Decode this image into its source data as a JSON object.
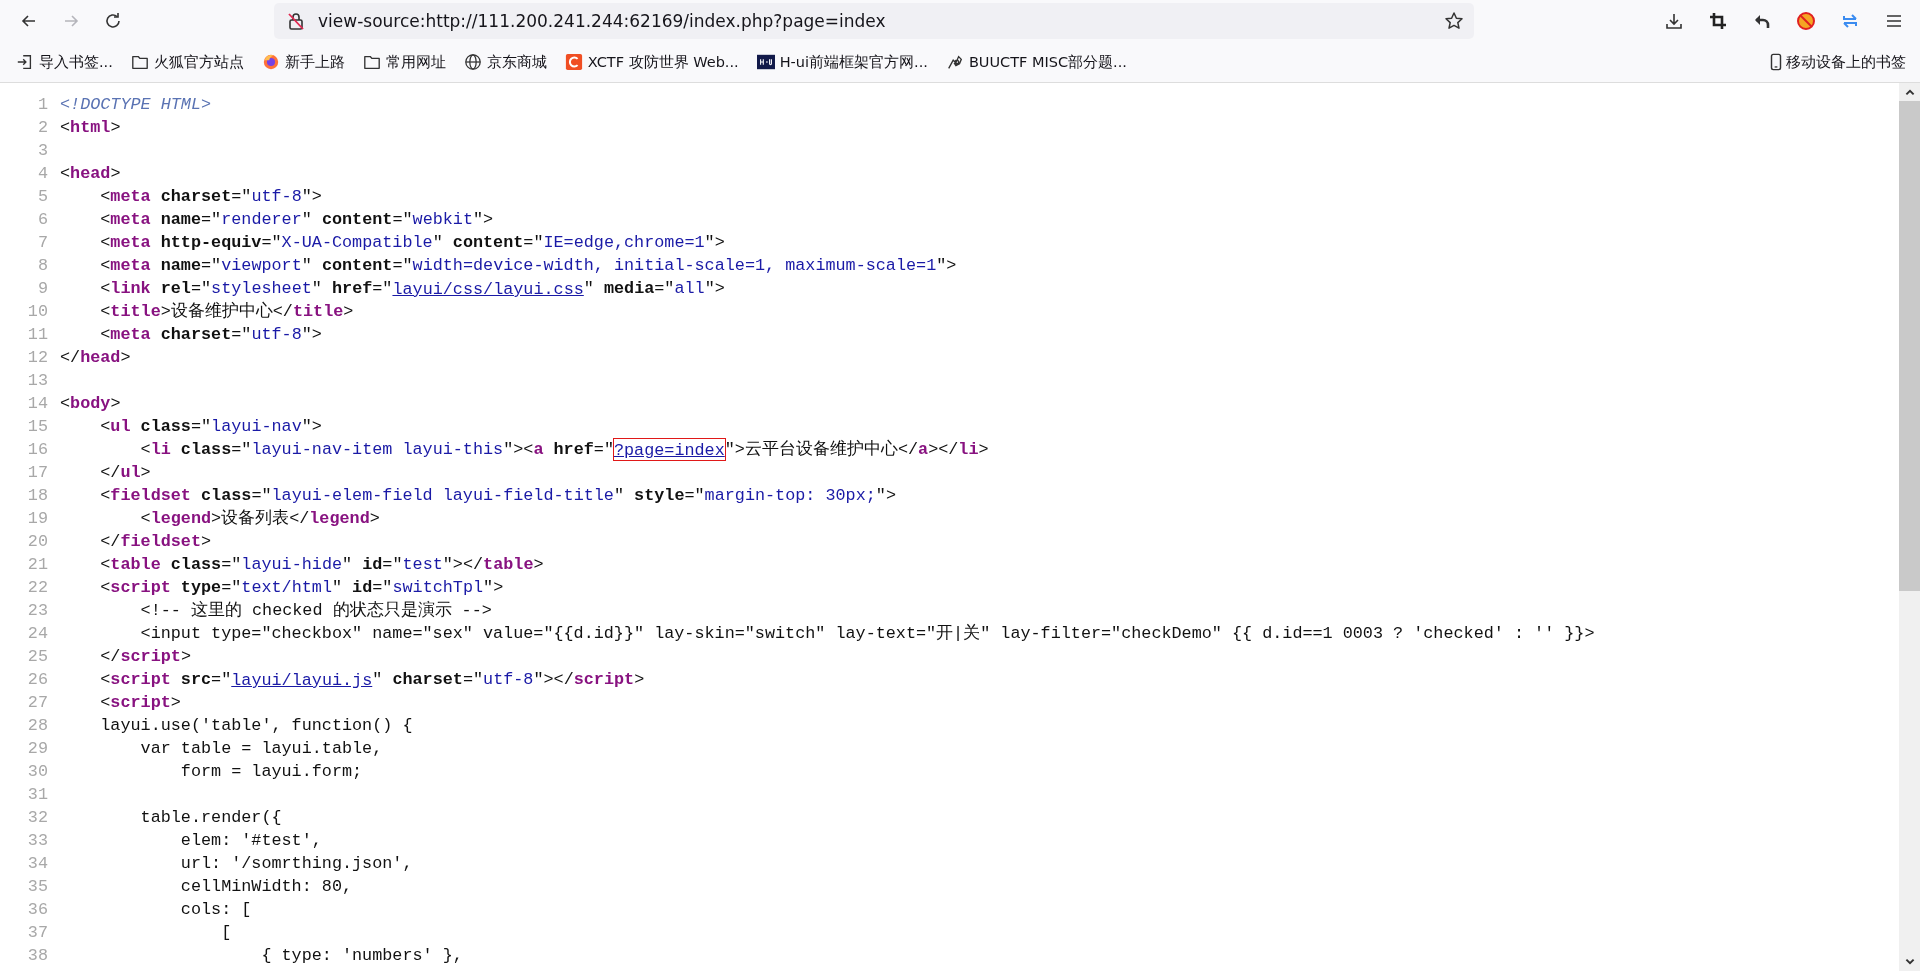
{
  "toolbar": {
    "nav_buttons": [
      {
        "kind": "back",
        "disabled": false
      },
      {
        "kind": "forward",
        "disabled": true
      },
      {
        "kind": "reload",
        "disabled": false
      }
    ],
    "url": "view-source:http://111.200.241.244:62169/index.php?page=index",
    "actions": [
      {
        "kind": "download"
      },
      {
        "kind": "crop"
      },
      {
        "kind": "undo"
      },
      {
        "kind": "addon"
      },
      {
        "kind": "sync"
      },
      {
        "kind": "menu"
      }
    ]
  },
  "bookmarks": [
    {
      "kind": "import",
      "label": "导入书签..."
    },
    {
      "kind": "folder",
      "label": "火狐官方站点"
    },
    {
      "kind": "firefox",
      "label": "新手上路"
    },
    {
      "kind": "folder",
      "label": "常用网址"
    },
    {
      "kind": "globe",
      "label": "京东商城"
    },
    {
      "kind": "c-logo",
      "label": "XCTF 攻防世界 Web..."
    },
    {
      "kind": "hui",
      "label": "H-ui前端框架官方网..."
    },
    {
      "kind": "bird",
      "label": "BUUCTF MISC部分题..."
    }
  ],
  "mobile_bookmarks": {
    "label": "移动设备上的书签"
  },
  "source_lines": [
    {
      "number": "1",
      "segments": [
        {
          "kind": "doctype",
          "text": "<!DOCTYPE HTML>"
        }
      ]
    },
    {
      "number": "2",
      "segments": [
        {
          "kind": "plain",
          "text": "<"
        },
        {
          "kind": "tag",
          "text": "html"
        },
        {
          "kind": "plain",
          "text": ">"
        }
      ]
    },
    {
      "number": "3"
    },
    {
      "number": "4",
      "segments": [
        {
          "kind": "plain",
          "text": "<"
        },
        {
          "kind": "tag",
          "text": "head"
        },
        {
          "kind": "plain",
          "text": ">"
        }
      ]
    },
    {
      "number": "5",
      "segments": [
        {
          "kind": "plain",
          "text": "    <"
        },
        {
          "kind": "tag",
          "text": "meta"
        },
        {
          "kind": "attr",
          "text": " charset"
        },
        {
          "kind": "plain",
          "text": "=\""
        },
        {
          "kind": "value",
          "text": "utf-8"
        },
        {
          "kind": "plain",
          "text": "\">"
        }
      ]
    },
    {
      "number": "6",
      "segments": [
        {
          "kind": "plain",
          "text": "    <"
        },
        {
          "kind": "tag",
          "text": "meta"
        },
        {
          "kind": "attr",
          "text": " name"
        },
        {
          "kind": "plain",
          "text": "=\""
        },
        {
          "kind": "value",
          "text": "renderer"
        },
        {
          "kind": "plain",
          "text": "\" "
        },
        {
          "kind": "attr",
          "text": "content"
        },
        {
          "kind": "plain",
          "text": "=\""
        },
        {
          "kind": "value",
          "text": "webkit"
        },
        {
          "kind": "plain",
          "text": "\">"
        }
      ]
    },
    {
      "number": "7",
      "segments": [
        {
          "kind": "plain",
          "text": "    <"
        },
        {
          "kind": "tag",
          "text": "meta"
        },
        {
          "kind": "attr",
          "text": " http-equiv"
        },
        {
          "kind": "plain",
          "text": "=\""
        },
        {
          "kind": "value",
          "text": "X-UA-Compatible"
        },
        {
          "kind": "plain",
          "text": "\" "
        },
        {
          "kind": "attr",
          "text": "content"
        },
        {
          "kind": "plain",
          "text": "=\""
        },
        {
          "kind": "value",
          "text": "IE=edge,chrome=1"
        },
        {
          "kind": "plain",
          "text": "\">"
        }
      ]
    },
    {
      "number": "8",
      "segments": [
        {
          "kind": "plain",
          "text": "    <"
        },
        {
          "kind": "tag",
          "text": "meta"
        },
        {
          "kind": "attr",
          "text": " name"
        },
        {
          "kind": "plain",
          "text": "=\""
        },
        {
          "kind": "value",
          "text": "viewport"
        },
        {
          "kind": "plain",
          "text": "\" "
        },
        {
          "kind": "attr",
          "text": "content"
        },
        {
          "kind": "plain",
          "text": "=\""
        },
        {
          "kind": "value",
          "text": "width=device-width, initial-scale=1, maximum-scale=1"
        },
        {
          "kind": "plain",
          "text": "\">"
        }
      ]
    },
    {
      "number": "9",
      "segments": [
        {
          "kind": "plain",
          "text": "    <"
        },
        {
          "kind": "tag",
          "text": "link"
        },
        {
          "kind": "attr",
          "text": " rel"
        },
        {
          "kind": "plain",
          "text": "=\""
        },
        {
          "kind": "value",
          "text": "stylesheet"
        },
        {
          "kind": "plain",
          "text": "\" "
        },
        {
          "kind": "attr",
          "text": "href"
        },
        {
          "kind": "plain",
          "text": "=\""
        },
        {
          "kind": "link",
          "text": "layui/css/layui.css"
        },
        {
          "kind": "plain",
          "text": "\" "
        },
        {
          "kind": "attr",
          "text": "media"
        },
        {
          "kind": "plain",
          "text": "=\""
        },
        {
          "kind": "value",
          "text": "all"
        },
        {
          "kind": "plain",
          "text": "\">"
        }
      ]
    },
    {
      "number": "10",
      "segments": [
        {
          "kind": "plain",
          "text": "    <"
        },
        {
          "kind": "tag",
          "text": "title"
        },
        {
          "kind": "plain",
          "text": ">设备维护中心</"
        },
        {
          "kind": "tag",
          "text": "title"
        },
        {
          "kind": "plain",
          "text": ">"
        }
      ]
    },
    {
      "number": "11",
      "segments": [
        {
          "kind": "plain",
          "text": "    <"
        },
        {
          "kind": "tag",
          "text": "meta"
        },
        {
          "kind": "attr",
          "text": " charset"
        },
        {
          "kind": "plain",
          "text": "=\""
        },
        {
          "kind": "value",
          "text": "utf-8"
        },
        {
          "kind": "plain",
          "text": "\">"
        }
      ]
    },
    {
      "number": "12",
      "segments": [
        {
          "kind": "plain",
          "text": "</"
        },
        {
          "kind": "tag",
          "text": "head"
        },
        {
          "kind": "plain",
          "text": ">"
        }
      ]
    },
    {
      "number": "13"
    },
    {
      "number": "14",
      "segments": [
        {
          "kind": "plain",
          "text": "<"
        },
        {
          "kind": "tag",
          "text": "body"
        },
        {
          "kind": "plain",
          "text": ">"
        }
      ]
    },
    {
      "number": "15",
      "segments": [
        {
          "kind": "plain",
          "text": "    <"
        },
        {
          "kind": "tag",
          "text": "ul"
        },
        {
          "kind": "attr",
          "text": " class"
        },
        {
          "kind": "plain",
          "text": "=\""
        },
        {
          "kind": "value",
          "text": "layui-nav"
        },
        {
          "kind": "plain",
          "text": "\">"
        }
      ]
    },
    {
      "number": "16",
      "segments": [
        {
          "kind": "plain",
          "text": "        <"
        },
        {
          "kind": "tag",
          "text": "li"
        },
        {
          "kind": "attr",
          "text": " class"
        },
        {
          "kind": "plain",
          "text": "=\""
        },
        {
          "kind": "value",
          "text": "layui-nav-item layui-this"
        },
        {
          "kind": "plain",
          "text": "\"><"
        },
        {
          "kind": "tag",
          "text": "a"
        },
        {
          "kind": "attr",
          "text": " href"
        },
        {
          "kind": "plain",
          "text": "=\""
        },
        {
          "kind": "link",
          "text": "?page=index",
          "highlighted": true
        },
        {
          "kind": "plain",
          "text": "\">云平台设备维护中心</"
        },
        {
          "kind": "tag",
          "text": "a"
        },
        {
          "kind": "plain",
          "text": "></"
        },
        {
          "kind": "tag",
          "text": "li"
        },
        {
          "kind": "plain",
          "text": ">"
        }
      ]
    },
    {
      "number": "17",
      "segments": [
        {
          "kind": "plain",
          "text": "    </"
        },
        {
          "kind": "tag",
          "text": "ul"
        },
        {
          "kind": "plain",
          "text": ">"
        }
      ]
    },
    {
      "number": "18",
      "segments": [
        {
          "kind": "plain",
          "text": "    <"
        },
        {
          "kind": "tag",
          "text": "fieldset"
        },
        {
          "kind": "attr",
          "text": " class"
        },
        {
          "kind": "plain",
          "text": "=\""
        },
        {
          "kind": "value",
          "text": "layui-elem-field layui-field-title"
        },
        {
          "kind": "plain",
          "text": "\" "
        },
        {
          "kind": "attr",
          "text": "style"
        },
        {
          "kind": "plain",
          "text": "=\""
        },
        {
          "kind": "value",
          "text": "margin-top: 30px;"
        },
        {
          "kind": "plain",
          "text": "\">"
        }
      ]
    },
    {
      "number": "19",
      "segments": [
        {
          "kind": "plain",
          "text": "        <"
        },
        {
          "kind": "tag",
          "text": "legend"
        },
        {
          "kind": "plain",
          "text": ">设备列表</"
        },
        {
          "kind": "tag",
          "text": "legend"
        },
        {
          "kind": "plain",
          "text": ">"
        }
      ]
    },
    {
      "number": "20",
      "segments": [
        {
          "kind": "plain",
          "text": "    </"
        },
        {
          "kind": "tag",
          "text": "fieldset"
        },
        {
          "kind": "plain",
          "text": ">"
        }
      ]
    },
    {
      "number": "21",
      "segments": [
        {
          "kind": "plain",
          "text": "    <"
        },
        {
          "kind": "tag",
          "text": "table"
        },
        {
          "kind": "attr",
          "text": " class"
        },
        {
          "kind": "plain",
          "text": "=\""
        },
        {
          "kind": "value",
          "text": "layui-hide"
        },
        {
          "kind": "plain",
          "text": "\" "
        },
        {
          "kind": "attr",
          "text": "id"
        },
        {
          "kind": "plain",
          "text": "=\""
        },
        {
          "kind": "value",
          "text": "test"
        },
        {
          "kind": "plain",
          "text": "\"></"
        },
        {
          "kind": "tag",
          "text": "table"
        },
        {
          "kind": "plain",
          "text": ">"
        }
      ]
    },
    {
      "number": "22",
      "segments": [
        {
          "kind": "plain",
          "text": "    <"
        },
        {
          "kind": "tag",
          "text": "script"
        },
        {
          "kind": "attr",
          "text": " type"
        },
        {
          "kind": "plain",
          "text": "=\""
        },
        {
          "kind": "value",
          "text": "text/html"
        },
        {
          "kind": "plain",
          "text": "\" "
        },
        {
          "kind": "attr",
          "text": "id"
        },
        {
          "kind": "plain",
          "text": "=\""
        },
        {
          "kind": "value",
          "text": "switchTpl"
        },
        {
          "kind": "plain",
          "text": "\">"
        }
      ]
    },
    {
      "number": "23",
      "segments": [
        {
          "kind": "plain",
          "text": "        <!-- 这里的 checked 的状态只是演示 -->"
        }
      ]
    },
    {
      "number": "24",
      "segments": [
        {
          "kind": "plain",
          "text": "        <input type=\"checkbox\" name=\"sex\" value=\"{{d.id}}\" lay-skin=\"switch\" lay-text=\"开|关\" lay-filter=\"checkDemo\" {{ d.id==1 0003 ? 'checked' : '' }}>"
        }
      ]
    },
    {
      "number": "25",
      "segments": [
        {
          "kind": "plain",
          "text": "    </"
        },
        {
          "kind": "tag",
          "text": "script"
        },
        {
          "kind": "plain",
          "text": ">"
        }
      ]
    },
    {
      "number": "26",
      "segments": [
        {
          "kind": "plain",
          "text": "    <"
        },
        {
          "kind": "tag",
          "text": "script"
        },
        {
          "kind": "attr",
          "text": " src"
        },
        {
          "kind": "plain",
          "text": "=\""
        },
        {
          "kind": "link",
          "text": "layui/layui.js"
        },
        {
          "kind": "plain",
          "text": "\" "
        },
        {
          "kind": "attr",
          "text": "charset"
        },
        {
          "kind": "plain",
          "text": "=\""
        },
        {
          "kind": "value",
          "text": "utf-8"
        },
        {
          "kind": "plain",
          "text": "\"></"
        },
        {
          "kind": "tag",
          "text": "script"
        },
        {
          "kind": "plain",
          "text": ">"
        }
      ]
    },
    {
      "number": "27",
      "segments": [
        {
          "kind": "plain",
          "text": "    <"
        },
        {
          "kind": "tag",
          "text": "script"
        },
        {
          "kind": "plain",
          "text": ">"
        }
      ]
    },
    {
      "number": "28",
      "segments": [
        {
          "kind": "plain",
          "text": "    layui.use('table', function() {"
        }
      ]
    },
    {
      "number": "29",
      "segments": [
        {
          "kind": "plain",
          "text": "        var table = layui.table,"
        }
      ]
    },
    {
      "number": "30",
      "segments": [
        {
          "kind": "plain",
          "text": "            form = layui.form;"
        }
      ]
    },
    {
      "number": "31"
    },
    {
      "number": "32",
      "segments": [
        {
          "kind": "plain",
          "text": "        table.render({"
        }
      ]
    },
    {
      "number": "33",
      "segments": [
        {
          "kind": "plain",
          "text": "            elem: '#test',"
        }
      ]
    },
    {
      "number": "34",
      "segments": [
        {
          "kind": "plain",
          "text": "            url: '/somrthing.json',"
        }
      ]
    },
    {
      "number": "35",
      "segments": [
        {
          "kind": "plain",
          "text": "            cellMinWidth: 80,"
        }
      ]
    },
    {
      "number": "36",
      "segments": [
        {
          "kind": "plain",
          "text": "            cols: ["
        }
      ]
    },
    {
      "number": "37",
      "segments": [
        {
          "kind": "plain",
          "text": "                ["
        }
      ]
    },
    {
      "number": "38",
      "segments": [
        {
          "kind": "plain",
          "text": "                    { type: 'numbers' },"
        }
      ]
    }
  ]
}
